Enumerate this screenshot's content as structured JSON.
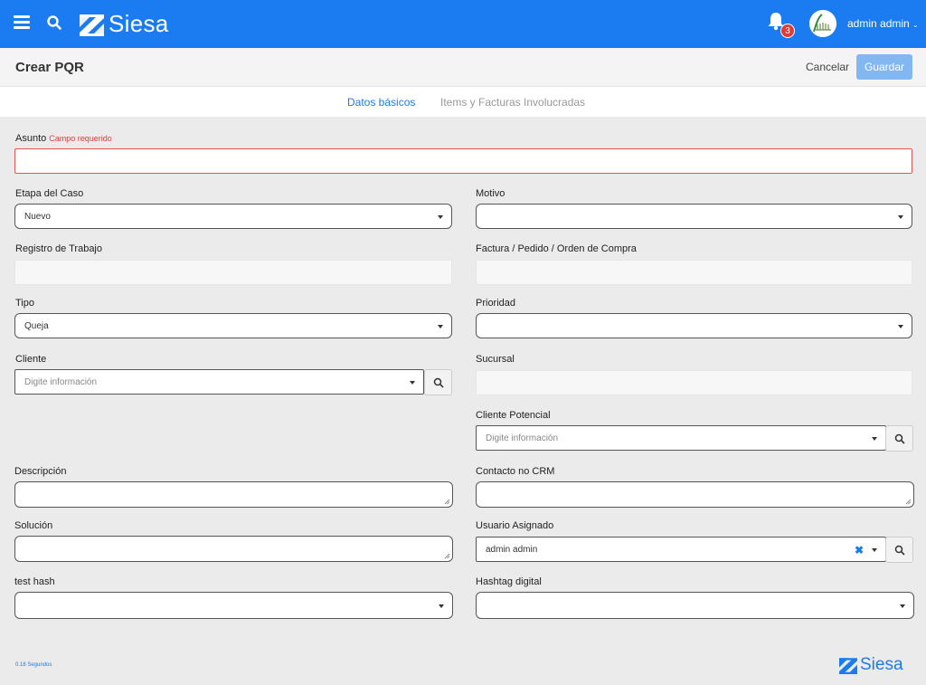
{
  "app": {
    "brand": "Siesa",
    "notifications_count": "3",
    "user_name": "admin admin"
  },
  "header": {
    "title": "Crear PQR",
    "cancel_label": "Cancelar",
    "save_label": "Guardar"
  },
  "tabs": [
    {
      "label": "Datos básicos",
      "active": true
    },
    {
      "label": "Items y Facturas Involucradas",
      "active": false
    }
  ],
  "form": {
    "asunto": {
      "label": "Asunto",
      "required_text": "Campo requerido",
      "value": ""
    },
    "etapa": {
      "label": "Etapa del Caso",
      "value": "Nuevo"
    },
    "motivo": {
      "label": "Motivo",
      "value": ""
    },
    "registro": {
      "label": "Registro de Trabajo",
      "value": ""
    },
    "factura": {
      "label": "Factura / Pedido / Orden de Compra",
      "value": ""
    },
    "tipo": {
      "label": "Tipo",
      "value": "Queja"
    },
    "prioridad": {
      "label": "Prioridad",
      "value": ""
    },
    "cliente": {
      "label": "Cliente",
      "placeholder": "Digite información"
    },
    "sucursal": {
      "label": "Sucursal",
      "value": ""
    },
    "cliente_potencial": {
      "label": "Cliente Potencial",
      "placeholder": "Digite información"
    },
    "descripcion": {
      "label": "Descripción",
      "value": ""
    },
    "contacto": {
      "label": "Contacto no CRM",
      "value": ""
    },
    "solucion": {
      "label": "Solución",
      "value": ""
    },
    "usuario": {
      "label": "Usuario Asignado",
      "value": "admin admin",
      "clear_glyph": "✖"
    },
    "test_hash": {
      "label": "test hash",
      "value": ""
    },
    "hashtag": {
      "label": "Hashtag digital",
      "value": ""
    }
  },
  "footer": {
    "timing_text": "0.18 Segundos",
    "brand": "Siesa"
  },
  "colors": {
    "primary": "#1a7cf0",
    "error": "#e53935",
    "save_button": "#82b7f2"
  },
  "icons": [
    "menu-icon",
    "search-icon",
    "siesa-logo",
    "bell-icon",
    "avatar",
    "chevron-down-icon",
    "caret-down-icon",
    "clear-icon"
  ]
}
